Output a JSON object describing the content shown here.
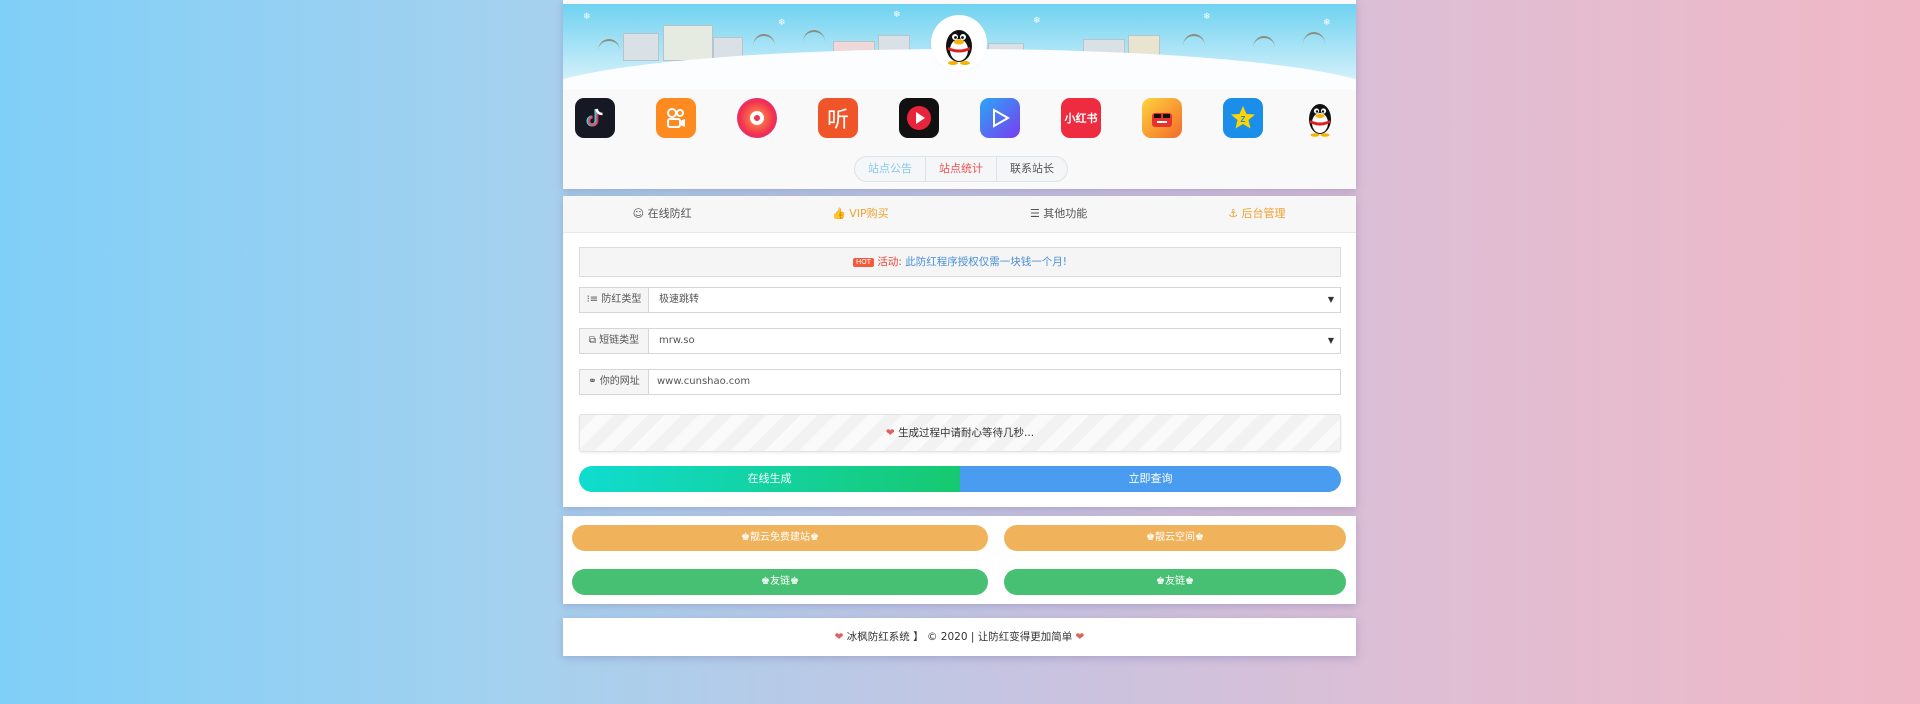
{
  "header": {
    "avatar_icon": "qq-penguin-icon",
    "apps": [
      {
        "name": "douyin-icon",
        "bg": "#161823",
        "glyph": "♪"
      },
      {
        "name": "kuaishou-icon",
        "bg": "#ff8a1f",
        "glyph": "⧉"
      },
      {
        "name": "weishi-icon",
        "bg": "#ff5a3c",
        "glyph": "◐"
      },
      {
        "name": "ting-icon",
        "bg": "#f0552a",
        "glyph": "听"
      },
      {
        "name": "video-play-icon",
        "bg": "#111111",
        "glyph": "▶"
      },
      {
        "name": "tencent-video-icon",
        "bg": "#3a6ff0",
        "glyph": "▷"
      },
      {
        "name": "xiaohongshu-icon",
        "bg": "#ef2b3f",
        "glyph": "小红书"
      },
      {
        "name": "cartoon-face-icon",
        "bg": "#f7b52c",
        "glyph": "☻"
      },
      {
        "name": "qzone-star-icon",
        "bg": "#1a8ee8",
        "glyph": "★"
      },
      {
        "name": "qq-icon",
        "bg": "#ffffff",
        "glyph": ""
      }
    ],
    "tabs": [
      {
        "label": "站点公告",
        "color": "#87c8ee"
      },
      {
        "label": "站点统计",
        "color": "#f05050"
      },
      {
        "label": "联系站长",
        "color": "#555555"
      }
    ]
  },
  "nav": [
    {
      "icon": "☺",
      "label": "在线防红",
      "color": "#555555"
    },
    {
      "icon": "👍",
      "label": "VIP购买",
      "color": "#f0a030"
    },
    {
      "icon": "☰",
      "label": "其他功能",
      "color": "#555555"
    },
    {
      "icon": "⚓",
      "label": "后台管理",
      "color": "#f0a030"
    }
  ],
  "notice": {
    "badge": "HOT",
    "prefix": "活动:",
    "text": "此防红程序授权仅需一块钱一个月!"
  },
  "form": {
    "type_label": "防红类型",
    "type_value": "极速跳转",
    "short_label": "短链类型",
    "short_value": "mrw.so",
    "url_label": "你的网址",
    "url_value": "www.cunshao.com"
  },
  "wait_text": "生成过程中请耐心等待几秒...",
  "buttons": {
    "generate": "在线生成",
    "query": "立即查询"
  },
  "links": [
    {
      "label": "♚靓云免费建站♚",
      "color": "#f0b25a"
    },
    {
      "label": "♚靓云空间♚",
      "color": "#f0b25a"
    },
    {
      "label": "♚友链♚",
      "color": "#48c074"
    },
    {
      "label": "♚友链♚",
      "color": "#48c074"
    }
  ],
  "footer": {
    "text": "冰枫防红系统 】 © 2020 | 让防红变得更加简单"
  },
  "colors": {
    "generate_gradient": [
      "#10dcd0",
      "#16c970"
    ],
    "query": "#4a9cf0"
  }
}
